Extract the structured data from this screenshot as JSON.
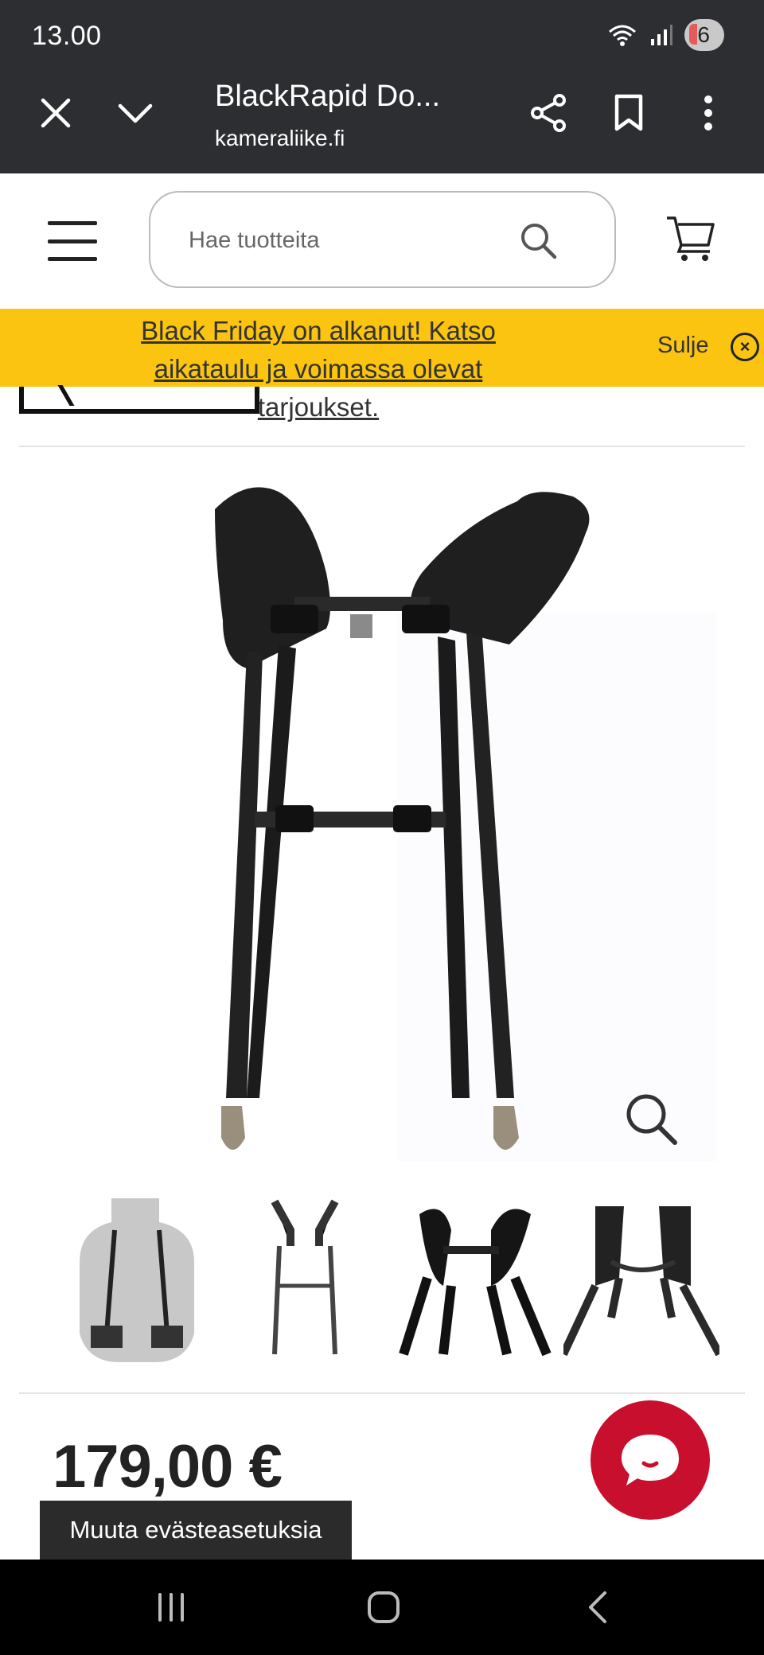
{
  "status_bar": {
    "time": "13.00",
    "battery": "6"
  },
  "browser": {
    "tab_title": "BlackRapid Do...",
    "url": "kameraliike.fi"
  },
  "header": {
    "search_placeholder": "Hae tuotteita"
  },
  "promo": {
    "text": "Black Friday on alkanut! Katso aikataulu ja voimassa olevat tarjoukset.",
    "close_label": "Sulje"
  },
  "product": {
    "price": "179,00 €",
    "thumbnail_count": 4
  },
  "cookie": {
    "label": "Muuta evästeasetuksia"
  },
  "colors": {
    "chrome_bg": "#2d2e31",
    "promo_bg": "#fbc410",
    "chat_red": "#c8102e",
    "nav_bg": "#000000"
  },
  "icons": [
    "close-icon",
    "chevron-down-icon",
    "share-icon",
    "bookmark-icon",
    "more-vert-icon",
    "menu-icon",
    "search-icon",
    "cart-icon",
    "circle-x-icon",
    "zoom-icon",
    "chat-icon",
    "recents-icon",
    "home-icon",
    "back-icon"
  ]
}
